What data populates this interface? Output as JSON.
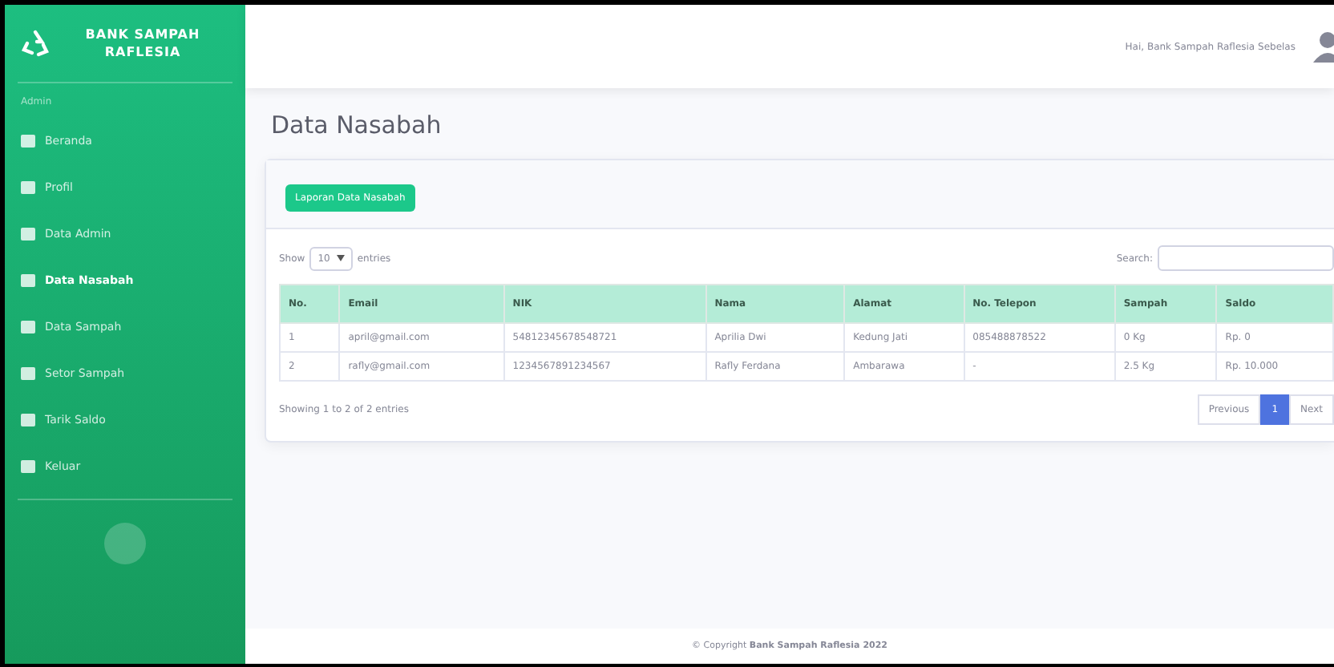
{
  "sidebar": {
    "brand": "BANK SAMPAH RAFLESIA",
    "heading": "Admin",
    "items": [
      {
        "label": "Beranda",
        "selected": false
      },
      {
        "label": "Profil",
        "selected": false
      },
      {
        "label": "Data Admin",
        "selected": false
      },
      {
        "label": "Data Nasabah",
        "selected": true
      },
      {
        "label": "Data Sampah",
        "selected": false
      },
      {
        "label": "Setor Sampah",
        "selected": false
      },
      {
        "label": "Tarik Saldo",
        "selected": false
      },
      {
        "label": "Keluar",
        "selected": false
      }
    ]
  },
  "topbar": {
    "user": "Hai, Bank Sampah Raflesia Sebelas"
  },
  "page": {
    "title": "Data Nasabah",
    "report_button": "Laporan Data Nasabah"
  },
  "table": {
    "show_label": "Show",
    "entries_value": "10",
    "entries_label": "entries",
    "search_label": "Search:",
    "columns": [
      "No.",
      "Email",
      "NIK",
      "Nama",
      "Alamat",
      "No. Telepon",
      "Sampah",
      "Saldo"
    ],
    "rows": [
      [
        "1",
        "april@gmail.com",
        "54812345678548721",
        "Aprilia Dwi",
        "Kedung Jati",
        "085488878522",
        "0 Kg",
        "Rp. 0"
      ],
      [
        "2",
        "rafly@gmail.com",
        "1234567891234567",
        "Rafly Ferdana",
        "Ambarawa",
        "-",
        "2.5 Kg",
        "Rp. 10.000"
      ]
    ],
    "info": "Showing 1 to 2 of 2 entries",
    "pagination": [
      {
        "label": "Previous",
        "selected": false
      },
      {
        "label": "1",
        "selected": true
      },
      {
        "label": "Next",
        "selected": false
      }
    ]
  },
  "footer": {
    "text": "© Copyright **Bank Sampah Raflesia 2022**"
  }
}
